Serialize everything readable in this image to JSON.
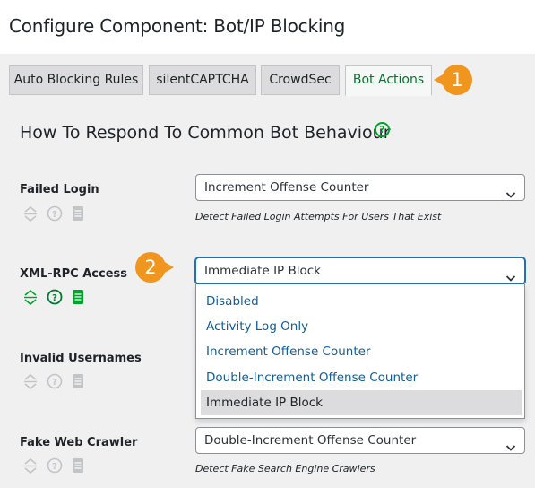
{
  "header": {
    "title": "Configure Component: Bot/IP Blocking"
  },
  "tabs": [
    {
      "label": "Auto Blocking Rules",
      "active": false
    },
    {
      "label": "silentCAPTCHA",
      "active": false
    },
    {
      "label": "CrowdSec",
      "active": false
    },
    {
      "label": "Bot Actions",
      "active": true
    }
  ],
  "badges": {
    "one": "1",
    "two": "2"
  },
  "section": {
    "title": "How To Respond To Common Bot Behaviour",
    "help": "?"
  },
  "rows": [
    {
      "label": "Failed Login",
      "value": "Increment Offense Counter",
      "description": "Detect Failed Login Attempts For Users That Exist"
    },
    {
      "label": "XML-RPC Access",
      "value": "Immediate IP Block",
      "description": ""
    },
    {
      "label": "Invalid Usernames",
      "value": "",
      "description": ""
    },
    {
      "label": "Fake Web Crawler",
      "value": "Double-Increment Offense Counter",
      "description": "Detect Fake Search Engine Crawlers"
    }
  ],
  "dropdown": {
    "options": [
      "Disabled",
      "Activity Log Only",
      "Increment Offense Counter",
      "Double-Increment Offense Counter",
      "Immediate IP Block"
    ],
    "selected": "Immediate IP Block"
  },
  "icon_help": "?",
  "colors": {
    "accent_green": "#00a32a",
    "active_tab_text": "#00782d",
    "badge_orange": "#f0961e",
    "link_blue": "#135e96",
    "inactive_icon": "#c3c4c7"
  }
}
